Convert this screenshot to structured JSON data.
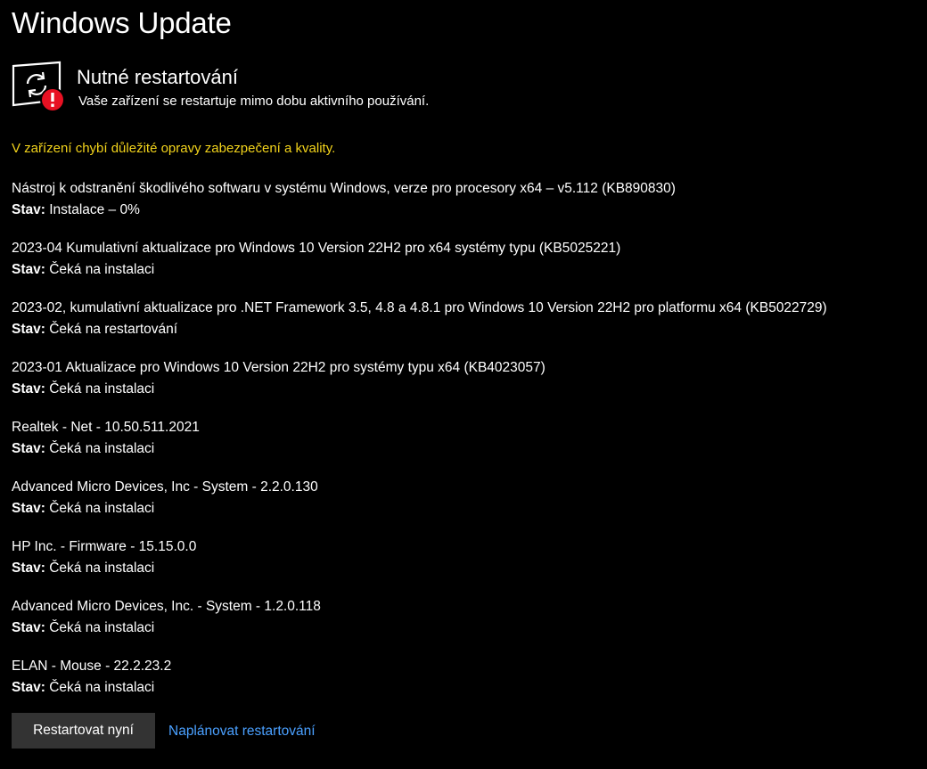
{
  "page": {
    "title": "Windows Update"
  },
  "status": {
    "icon": "restart-required-icon",
    "heading": "Nutné restartování",
    "subtext": "Vaše zařízení se restartuje mimo dobu aktivního používání."
  },
  "warning": {
    "text": "V zařízení chybí důležité opravy zabezpečení a kvality.",
    "color": "#f2d31b"
  },
  "updates": [
    {
      "name": "Nástroj k odstranění škodlivého softwaru v systému Windows, verze pro procesory x64 – v5.112 (KB890830)",
      "status_label": "Stav:",
      "status_value": " Instalace – 0%"
    },
    {
      "name": "2023-04 Kumulativní aktualizace pro Windows 10 Version 22H2 pro x64 systémy typu (KB5025221)",
      "status_label": "Stav:",
      "status_value": " Čeká na instalaci"
    },
    {
      "name": "2023-02, kumulativní aktualizace pro .NET Framework 3.5, 4.8 a 4.8.1 pro Windows 10 Version 22H2 pro platformu x64 (KB5022729)",
      "status_label": "Stav:",
      "status_value": " Čeká na restartování"
    },
    {
      "name": "2023-01 Aktualizace pro Windows 10 Version 22H2 pro systémy typu x64 (KB4023057)",
      "status_label": "Stav:",
      "status_value": " Čeká na instalaci"
    },
    {
      "name": "Realtek - Net - 10.50.511.2021",
      "status_label": "Stav:",
      "status_value": " Čeká na instalaci"
    },
    {
      "name": "Advanced Micro Devices, Inc - System - 2.2.0.130",
      "status_label": "Stav:",
      "status_value": " Čeká na instalaci"
    },
    {
      "name": "HP Inc. - Firmware - 15.15.0.0",
      "status_label": "Stav:",
      "status_value": " Čeká na instalaci"
    },
    {
      "name": "Advanced Micro Devices, Inc. - System - 1.2.0.118",
      "status_label": "Stav:",
      "status_value": " Čeká na instalaci"
    },
    {
      "name": "ELAN - Mouse - 22.2.23.2",
      "status_label": "Stav:",
      "status_value": " Čeká na instalaci"
    }
  ],
  "actions": {
    "restart_now_label": "Restartovat nyní",
    "schedule_restart_label": "Naplánovat restartování"
  },
  "colors": {
    "background": "#000000",
    "text": "#ffffff",
    "button_background": "#333333",
    "link": "#4aa0ff",
    "error_badge": "#e81123"
  }
}
